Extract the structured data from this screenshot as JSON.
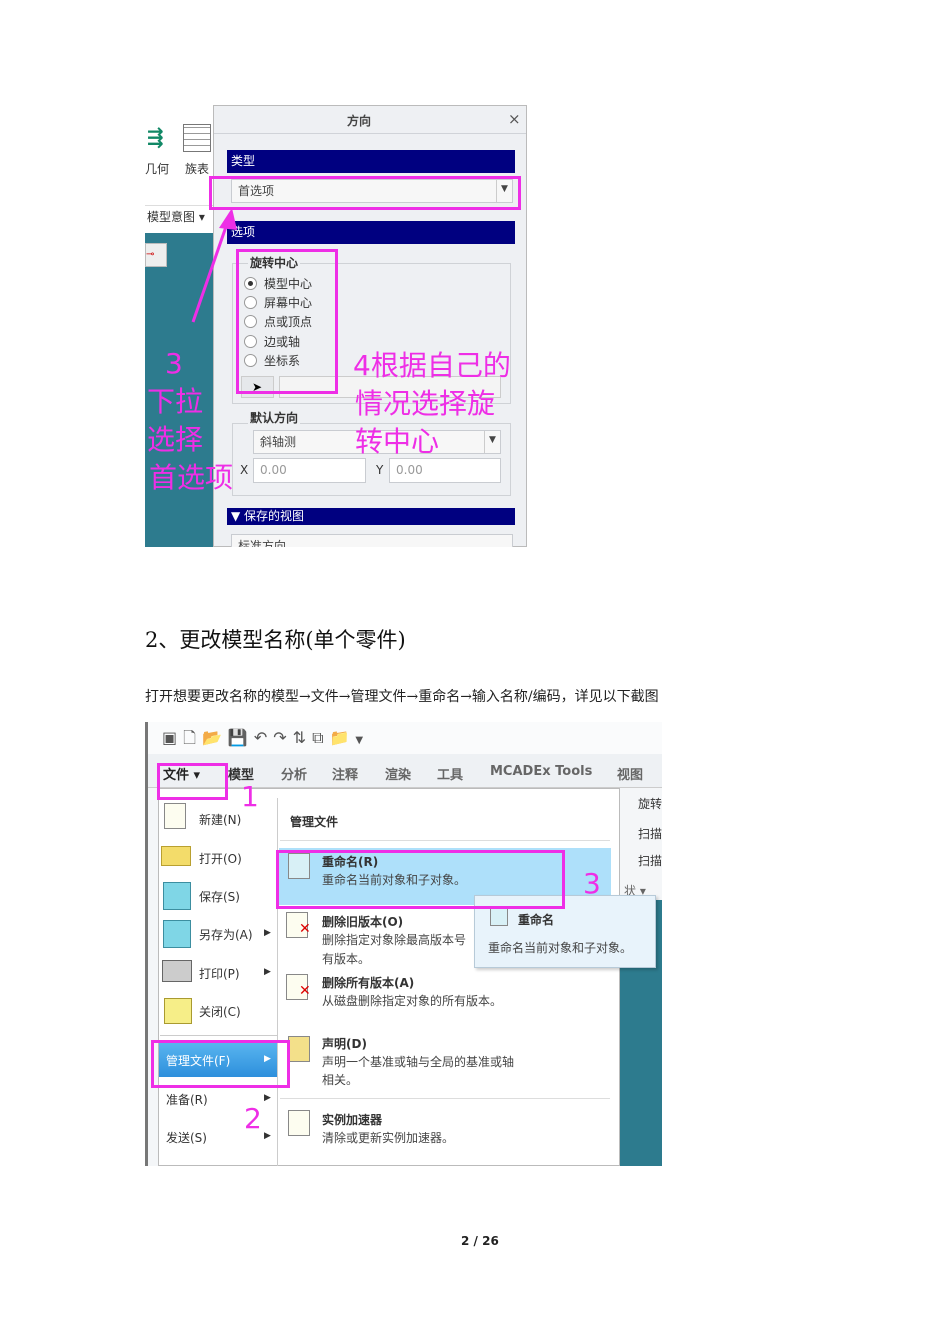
{
  "shot1": {
    "left_labels": [
      "几何",
      "族表",
      "模型意图 ▾"
    ],
    "dialog_title": "方向",
    "close": "×",
    "type_section": "类型",
    "type_value": "首选项",
    "options_section": "选项",
    "rotation_center_label": "旋转中心",
    "rotation_options": [
      {
        "label": "模型中心",
        "selected": true
      },
      {
        "label": "屏幕中心",
        "selected": false
      },
      {
        "label": "点或顶点",
        "selected": false
      },
      {
        "label": "边或轴",
        "selected": false
      },
      {
        "label": "坐标系",
        "selected": false
      }
    ],
    "default_orientation_label": "默认方向",
    "default_orientation_value": "斜轴测",
    "x_label": "X",
    "x_value": "0.00",
    "y_label": "Y",
    "y_value": "0.00",
    "saved_views_section": "保存的视图",
    "saved_view_first": "标准方向",
    "annotation_3": [
      "3",
      "下拉",
      "选择",
      "首选项"
    ],
    "annotation_4": [
      "4根据自己的",
      "情况选择旋",
      "转中心"
    ]
  },
  "heading": "2、更改模型名称(单个零件)",
  "instruction": "打开想要更改名称的模型→文件→管理文件→重命名→输入名称/编码，详见以下截图",
  "shot2": {
    "tabs": [
      "文件 ▾",
      "模型",
      "分析",
      "注释",
      "渲染",
      "工具",
      "MCADEx Tools",
      "视图"
    ],
    "left_menu": [
      {
        "label": "新建(N)"
      },
      {
        "label": "打开(O)"
      },
      {
        "label": "保存(S)"
      },
      {
        "label": "另存为(A)",
        "submenu": true
      },
      {
        "label": "打印(P)",
        "submenu": true
      },
      {
        "label": "关闭(C)"
      }
    ],
    "manage_files": "管理文件(F)",
    "prepare": "准备(R)",
    "send": "发送(S)",
    "panel_title": "管理文件",
    "items": [
      {
        "title": "重命名(R)",
        "desc": "重命名当前对象和子对象。"
      },
      {
        "title": "删除旧版本(O)",
        "desc": "删除指定对象除最高版本号",
        "desc2": "有版本。"
      },
      {
        "title": "删除所有版本(A)",
        "desc": "从磁盘删除指定对象的所有版本。"
      },
      {
        "title": "声明(D)",
        "desc": "声明一个基准或轴与全局的基准或轴",
        "desc2": "相关。"
      },
      {
        "title": "实例加速器",
        "desc": "清除或更新实例加速器。"
      }
    ],
    "tooltip_title": "重命名",
    "tooltip_desc": "重命名当前对象和子对象。",
    "right_strip": [
      "旋转",
      "扫描",
      "扫描",
      "状 ▾"
    ],
    "annotations": [
      "1",
      "2",
      "3"
    ]
  },
  "page_number": "2 / 26"
}
